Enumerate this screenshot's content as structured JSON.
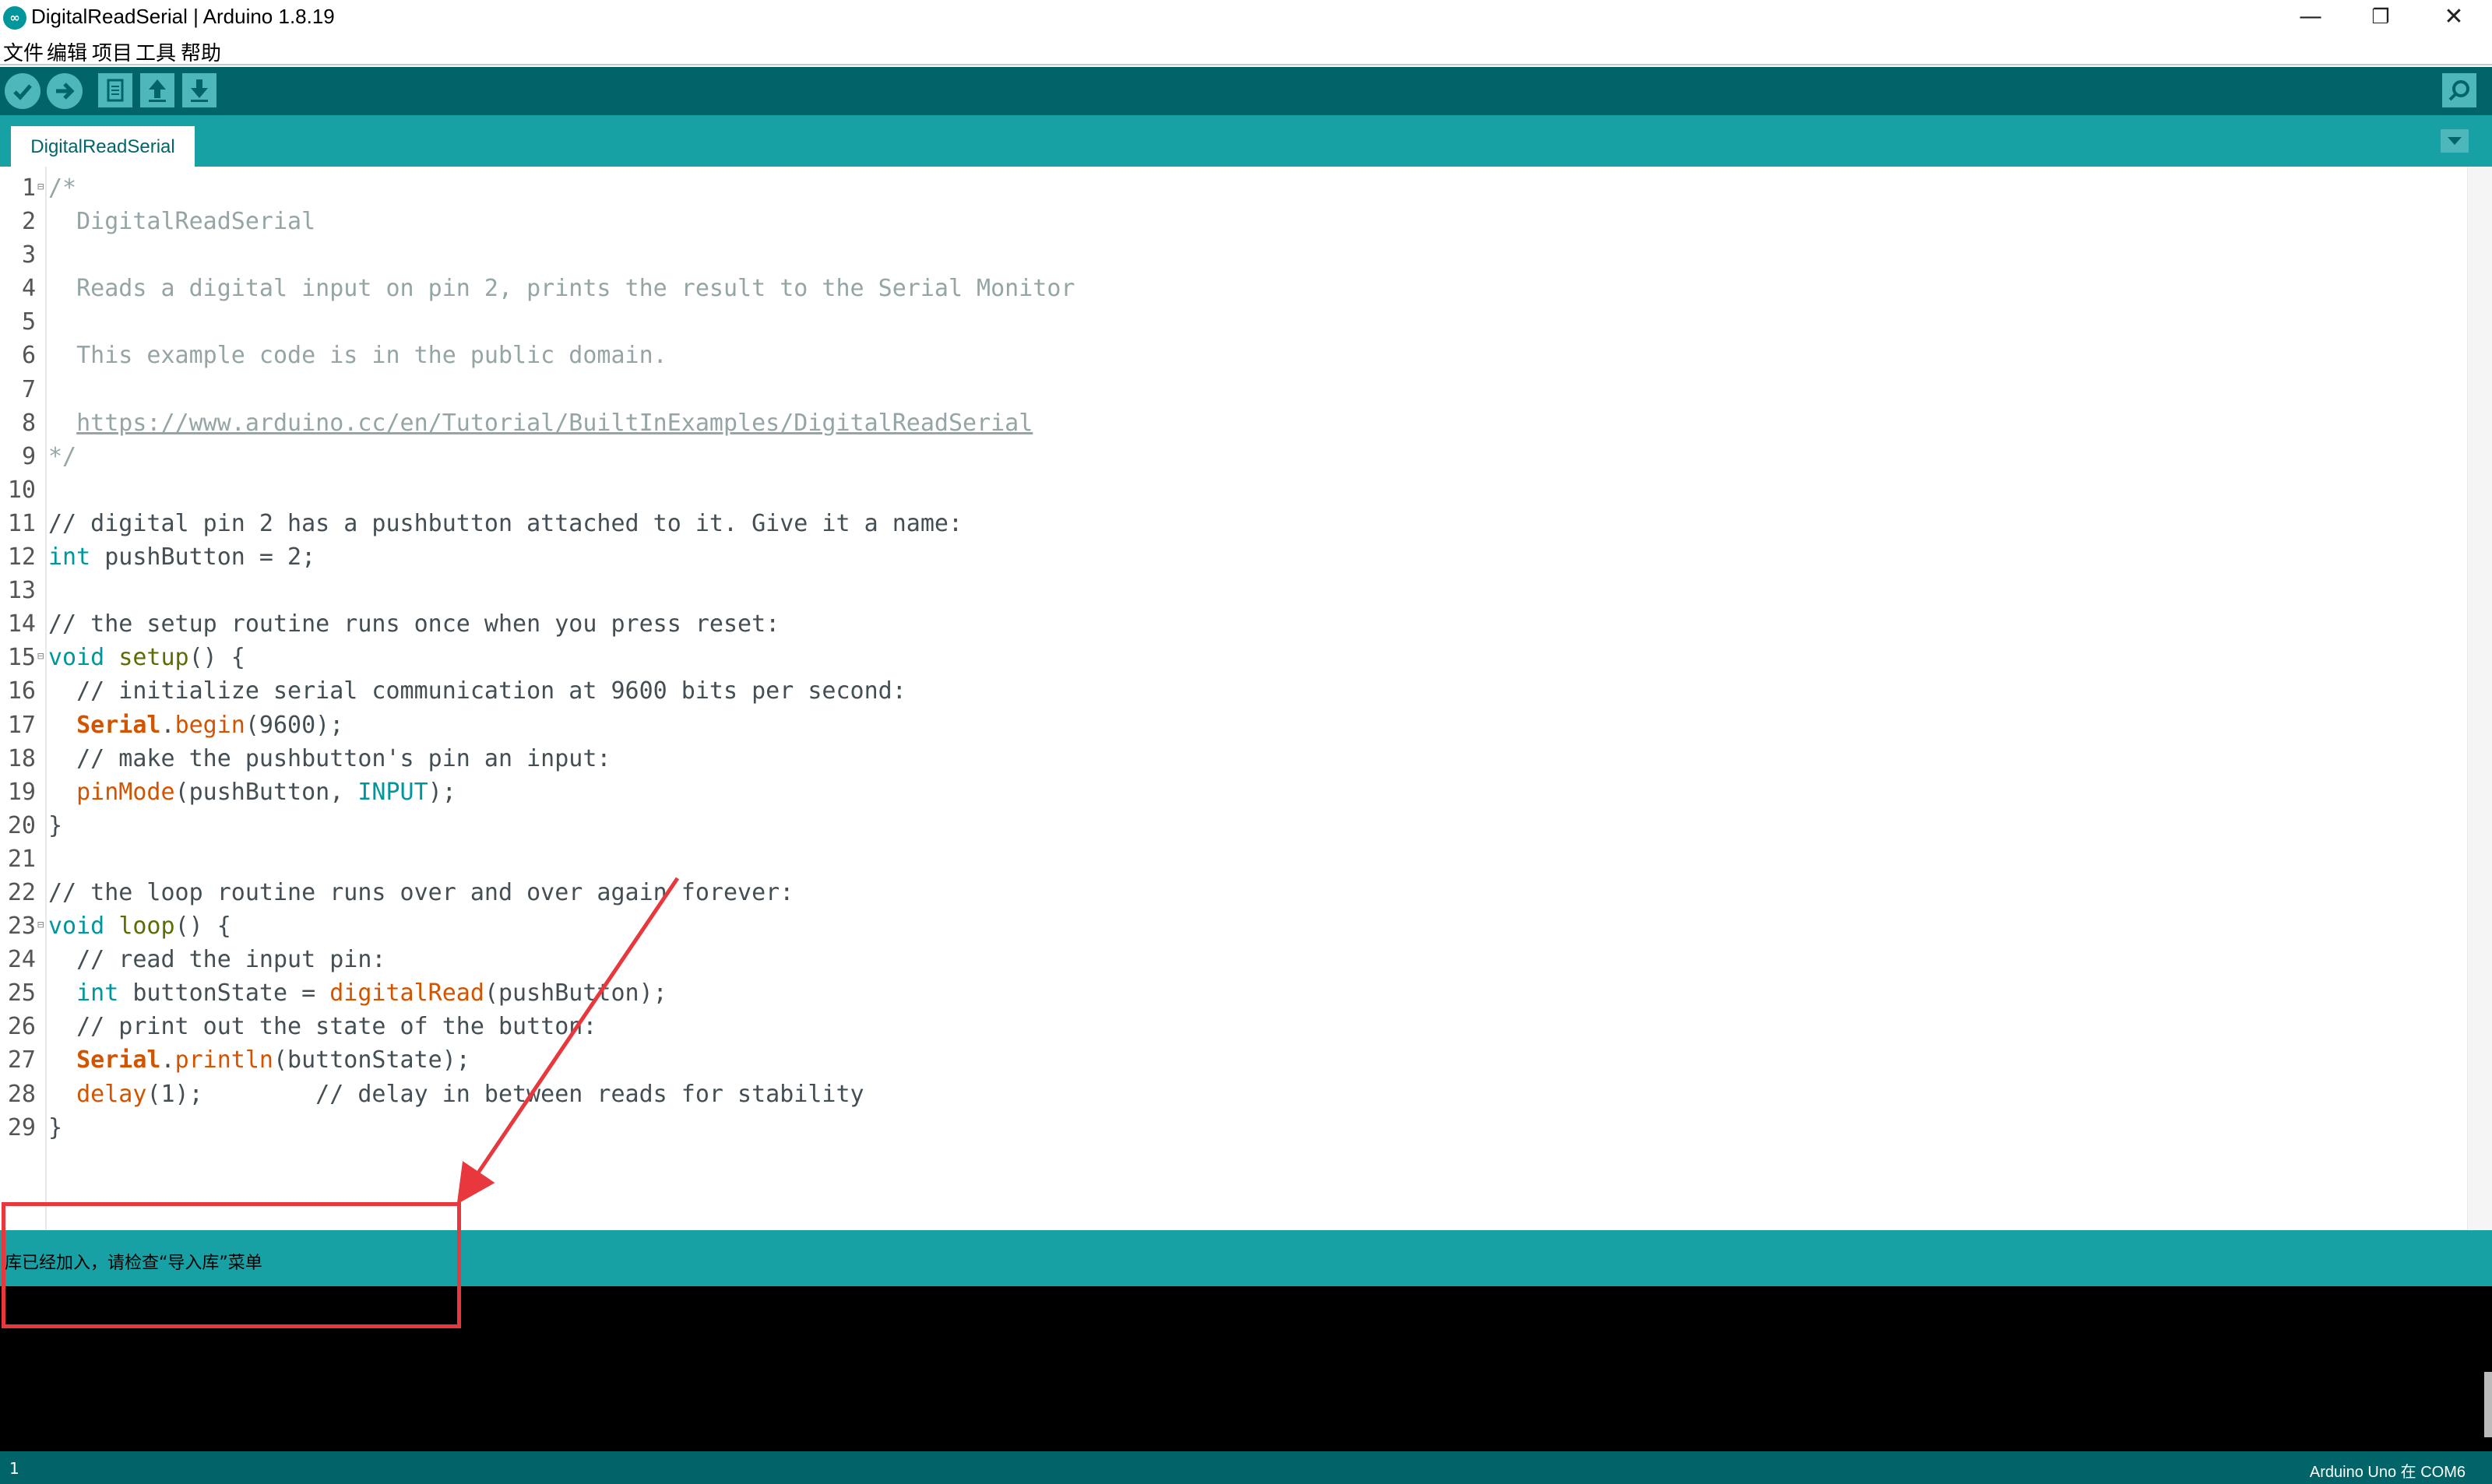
{
  "window": {
    "title": "DigitalReadSerial | Arduino 1.8.19",
    "minimize_glyph": "—",
    "maximize_glyph": "❐",
    "close_glyph": "✕"
  },
  "menu": [
    "文件",
    "编辑",
    "项目",
    "工具",
    "帮助"
  ],
  "toolbar": {
    "buttons": [
      "verify-icon",
      "upload-icon",
      "new-icon",
      "open-icon",
      "save-icon"
    ],
    "serial_monitor": "serial-monitor-icon"
  },
  "tabs": [
    {
      "label": "DigitalReadSerial"
    }
  ],
  "editor": {
    "lines": [
      {
        "n": "1",
        "fold": true,
        "tokens": [
          [
            "/*",
            "comment"
          ]
        ]
      },
      {
        "n": "2",
        "tokens": [
          [
            "  DigitalReadSerial",
            "comment"
          ]
        ]
      },
      {
        "n": "3",
        "tokens": []
      },
      {
        "n": "4",
        "tokens": [
          [
            "  Reads a digital input on pin 2, prints the result to the Serial Monitor",
            "comment"
          ]
        ]
      },
      {
        "n": "5",
        "tokens": []
      },
      {
        "n": "6",
        "tokens": [
          [
            "  This example code is in the public domain.",
            "comment"
          ]
        ]
      },
      {
        "n": "7",
        "tokens": []
      },
      {
        "n": "8",
        "tokens": [
          [
            "  ",
            "comment"
          ],
          [
            "https://www.arduino.cc/en/Tutorial/BuiltInExamples/DigitalReadSerial",
            "url"
          ]
        ]
      },
      {
        "n": "9",
        "tokens": [
          [
            "*/",
            "comment"
          ]
        ]
      },
      {
        "n": "10",
        "tokens": []
      },
      {
        "n": "11",
        "tokens": [
          [
            "// digital pin 2 has a pushbutton attached to it. Give it a name:",
            "plain"
          ]
        ]
      },
      {
        "n": "12",
        "tokens": [
          [
            "int",
            "type"
          ],
          [
            " pushButton = 2;",
            "plain"
          ]
        ]
      },
      {
        "n": "13",
        "tokens": []
      },
      {
        "n": "14",
        "tokens": [
          [
            "// the setup routine runs once when you press reset:",
            "plain"
          ]
        ]
      },
      {
        "n": "15",
        "fold": true,
        "tokens": [
          [
            "void",
            "type"
          ],
          [
            " ",
            "plain"
          ],
          [
            "setup",
            "func"
          ],
          [
            "() {",
            "plain"
          ]
        ]
      },
      {
        "n": "16",
        "tokens": [
          [
            "  // initialize serial communication at 9600 bits per second:",
            "plain"
          ]
        ]
      },
      {
        "n": "17",
        "tokens": [
          [
            "  ",
            "plain"
          ],
          [
            "Serial",
            "bold"
          ],
          [
            ".",
            "plain"
          ],
          [
            "begin",
            "fn"
          ],
          [
            "(9600);",
            "plain"
          ]
        ]
      },
      {
        "n": "18",
        "tokens": [
          [
            "  // make the pushbutton's pin an input:",
            "plain"
          ]
        ]
      },
      {
        "n": "19",
        "tokens": [
          [
            "  ",
            "plain"
          ],
          [
            "pinMode",
            "fn"
          ],
          [
            "(pushButton, ",
            "plain"
          ],
          [
            "INPUT",
            "type"
          ],
          [
            ");",
            "plain"
          ]
        ]
      },
      {
        "n": "20",
        "tokens": [
          [
            "}",
            "plain"
          ]
        ]
      },
      {
        "n": "21",
        "tokens": []
      },
      {
        "n": "22",
        "tokens": [
          [
            "// the loop routine runs over and over again forever:",
            "plain"
          ]
        ]
      },
      {
        "n": "23",
        "fold": true,
        "tokens": [
          [
            "void",
            "type"
          ],
          [
            " ",
            "plain"
          ],
          [
            "loop",
            "func"
          ],
          [
            "() {",
            "plain"
          ]
        ]
      },
      {
        "n": "24",
        "tokens": [
          [
            "  // read the input pin:",
            "plain"
          ]
        ]
      },
      {
        "n": "25",
        "tokens": [
          [
            "  ",
            "plain"
          ],
          [
            "int",
            "type"
          ],
          [
            " buttonState = ",
            "plain"
          ],
          [
            "digitalRead",
            "fn"
          ],
          [
            "(pushButton);",
            "plain"
          ]
        ]
      },
      {
        "n": "26",
        "tokens": [
          [
            "  // print out the state of the button:",
            "plain"
          ]
        ]
      },
      {
        "n": "27",
        "tokens": [
          [
            "  ",
            "plain"
          ],
          [
            "Serial",
            "bold"
          ],
          [
            ".",
            "plain"
          ],
          [
            "println",
            "fn"
          ],
          [
            "(buttonState);",
            "plain"
          ]
        ]
      },
      {
        "n": "28",
        "tokens": [
          [
            "  ",
            "plain"
          ],
          [
            "delay",
            "fn"
          ],
          [
            "(1);        // delay in between reads for stability",
            "plain"
          ]
        ]
      },
      {
        "n": "29",
        "tokens": [
          [
            "}",
            "plain"
          ]
        ]
      }
    ]
  },
  "status": {
    "message": "库已经加入，请检查“导入库”菜单"
  },
  "bottom": {
    "line_number": "1",
    "board": "Arduino Uno 在 COM6"
  },
  "annotation": {
    "color": "#e8383d"
  }
}
